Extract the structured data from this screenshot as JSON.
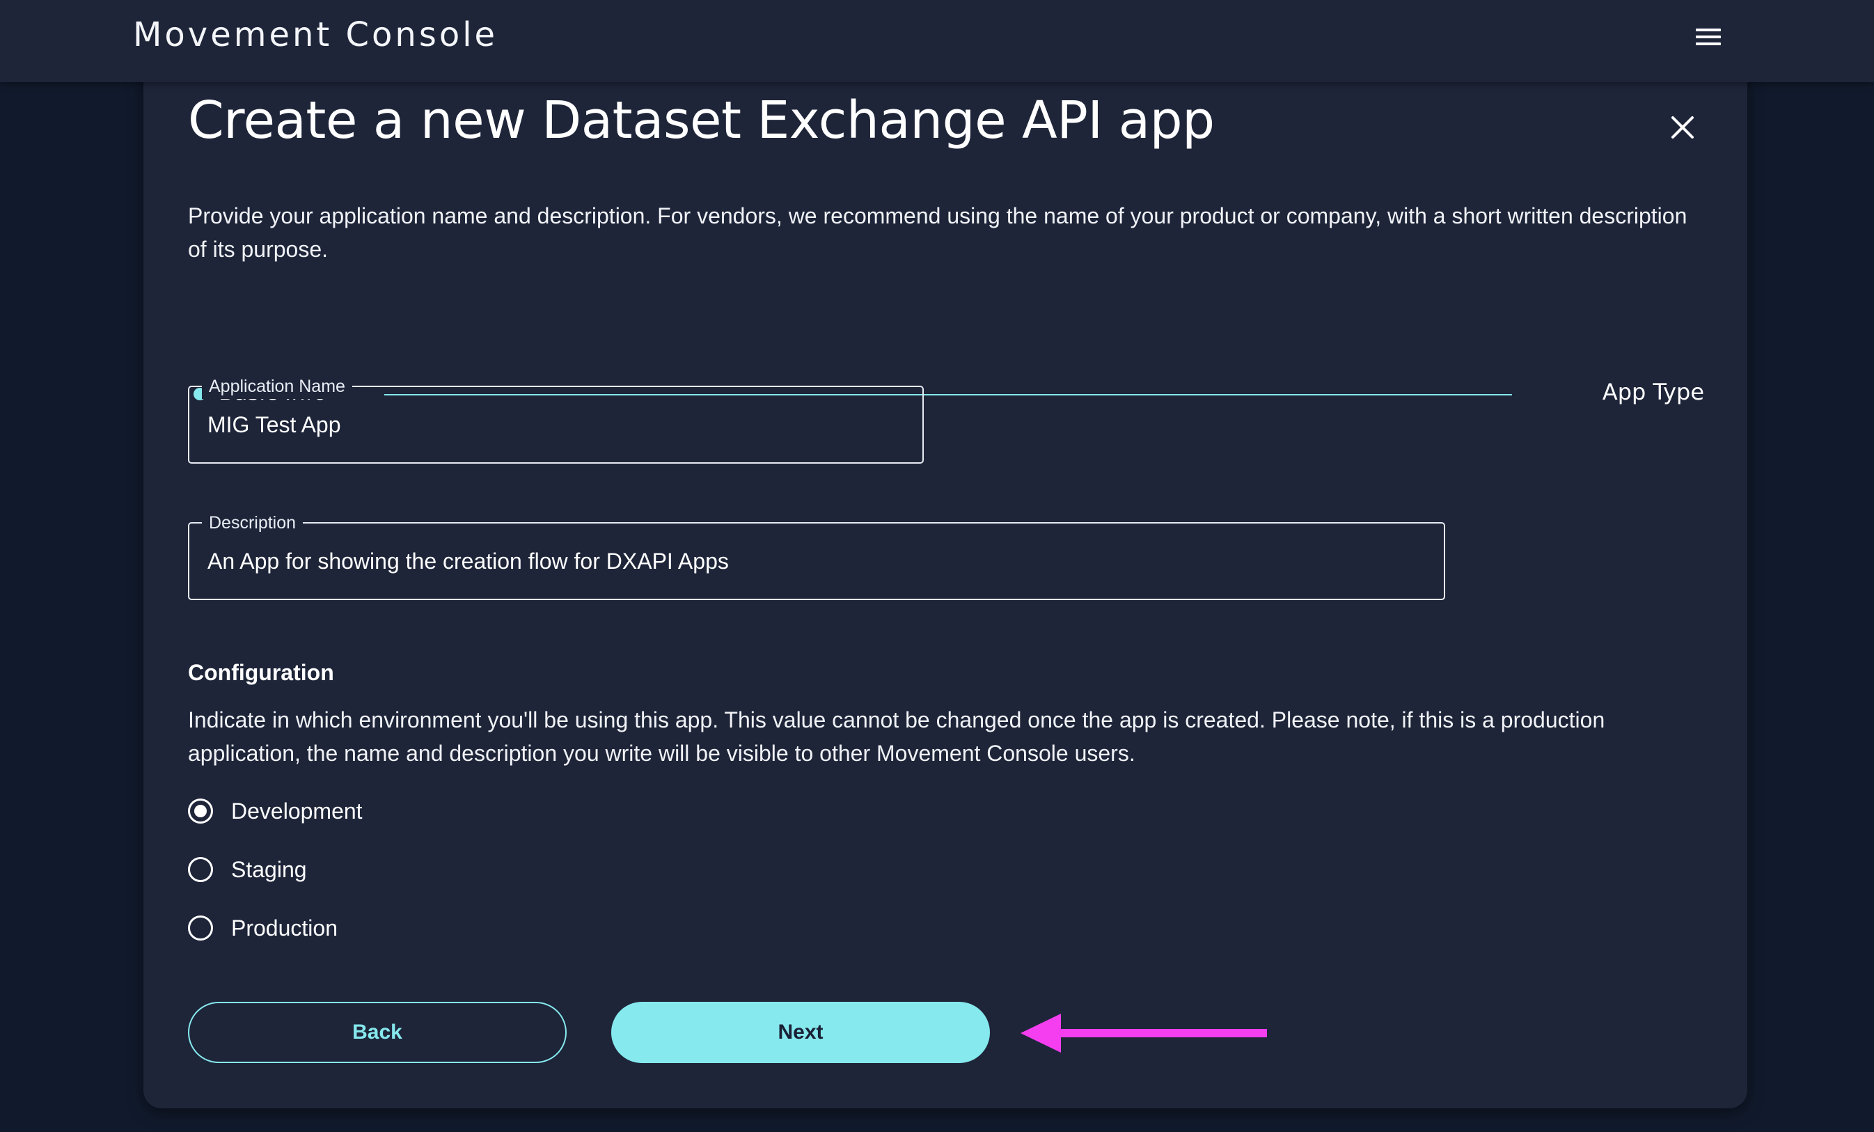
{
  "app": {
    "title": "Movement Console"
  },
  "modal": {
    "title": "Create a new Dataset Exchange API app",
    "intro": "Provide your application name and description. For vendors, we recommend using the name of your product or company, with a short written description of its purpose."
  },
  "stepper": {
    "steps": [
      {
        "label": "Basic Info",
        "active": true
      },
      {
        "label": "App Type",
        "active": false
      }
    ]
  },
  "form": {
    "name": {
      "label": "Application Name",
      "value": "MIG Test App"
    },
    "description": {
      "label": "Description",
      "value": "An App for showing the creation flow for DXAPI Apps"
    }
  },
  "configuration": {
    "title": "Configuration",
    "text": "Indicate in which environment you'll be using this app. This value cannot be changed once the app is created. Please note, if this is a production application, the name and description you write will be visible to other Movement Console users.",
    "options": [
      {
        "label": "Development",
        "selected": true
      },
      {
        "label": "Staging",
        "selected": false
      },
      {
        "label": "Production",
        "selected": false
      }
    ]
  },
  "actions": {
    "back_label": "Back",
    "next_label": "Next"
  },
  "colors": {
    "accent": "#86e9ee",
    "panel": "#1e2539",
    "background": "#111a2c",
    "annotation_arrow": "#f43ef0"
  },
  "icons": {
    "menu": "hamburger-menu-icon",
    "close": "close-icon",
    "annotation": "arrow-left-icon"
  }
}
